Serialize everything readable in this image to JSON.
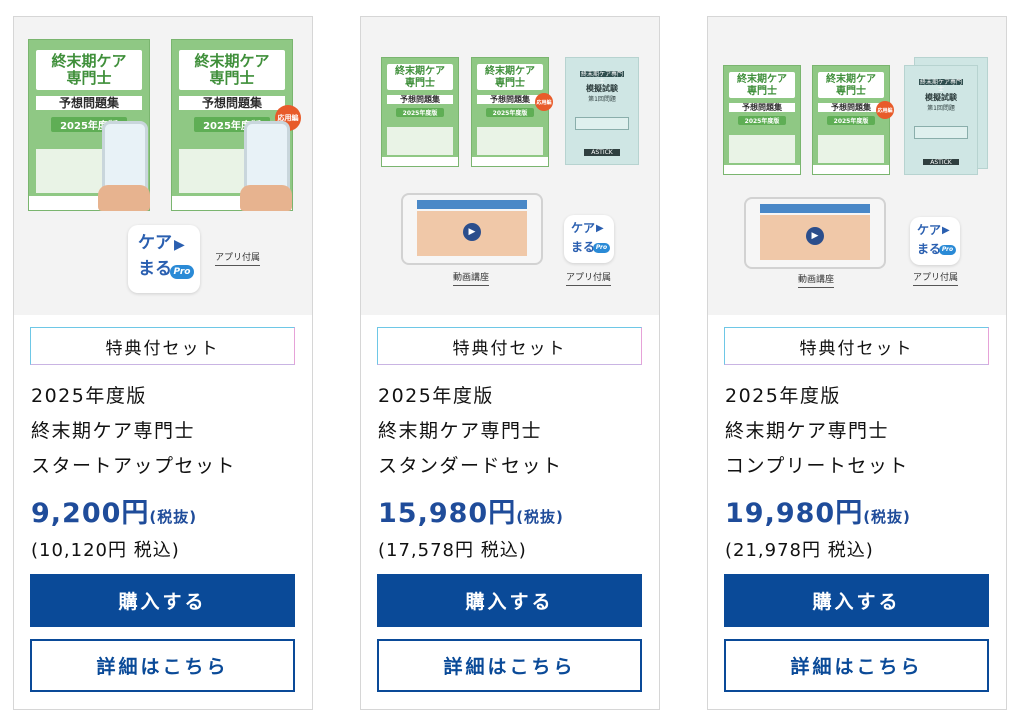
{
  "products": [
    {
      "tag": "特典付セット",
      "name_line1": "2025年度版",
      "name_line2": "終末期ケア専門士",
      "name_line3": "スタートアップセット",
      "price": "9,200円",
      "tax_note": "(税抜)",
      "price_incl": "(10,120円 税込)",
      "buy_label": "購入する",
      "detail_label": "詳細はこちら",
      "app_caption": "アプリ付属"
    },
    {
      "tag": "特典付セット",
      "name_line1": "2025年度版",
      "name_line2": "終末期ケア専門士",
      "name_line3": "スタンダードセット",
      "price": "15,980円",
      "tax_note": "(税抜)",
      "price_incl": "(17,578円 税込)",
      "buy_label": "購入する",
      "detail_label": "詳細はこちら",
      "video_caption": "動画講座",
      "app_caption": "アプリ付属"
    },
    {
      "tag": "特典付セット",
      "name_line1": "2025年度版",
      "name_line2": "終末期ケア専門士",
      "name_line3": "コンプリートセット",
      "price": "19,980円",
      "tax_note": "(税抜)",
      "price_incl": "(21,978円 税込)",
      "buy_label": "購入する",
      "detail_label": "詳細はこちら",
      "video_caption": "動画講座",
      "app_caption": "アプリ付属"
    }
  ],
  "book": {
    "title": "終末期ケア",
    "title2": "専門士",
    "subtitle": "予想問題集",
    "year": "2025年度版",
    "applied_badge": "応用編"
  },
  "mock_exam": {
    "header": "終末期ケア専門士",
    "title": "模擬試験",
    "round": "第1回問題",
    "logo": "ASTICK"
  },
  "app": {
    "line1": "ケア",
    "line2": "まる",
    "pro": "Pro",
    "play_glyph": "▶"
  },
  "colors": {
    "brand_blue": "#0a4a98",
    "price_blue": "#1f4c9a",
    "book_green": "#8fc884"
  }
}
